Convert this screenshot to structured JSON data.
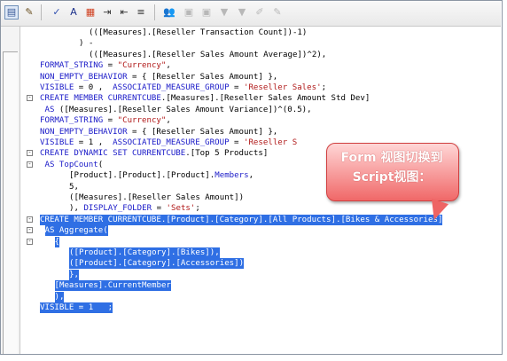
{
  "toolbar": {
    "buttons": [
      {
        "name": "form-view",
        "glyph": "▤",
        "color": "#3a5a98",
        "pressed": true
      },
      {
        "name": "script-view",
        "glyph": "✎",
        "color": "#6a5020",
        "pressed": false
      },
      {
        "name": "check-syntax",
        "glyph": "✓",
        "color": "#3050b0",
        "pressed": false
      },
      {
        "name": "font",
        "glyph": "A",
        "color": "#1a2f8a",
        "pressed": false
      },
      {
        "name": "color",
        "glyph": "▦",
        "color": "#d04020",
        "pressed": false
      },
      {
        "name": "indent",
        "glyph": "⇥",
        "color": "#333333",
        "pressed": false
      },
      {
        "name": "outdent",
        "glyph": "⇤",
        "color": "#333333",
        "pressed": false
      },
      {
        "name": "align",
        "glyph": "≡",
        "color": "#333333",
        "pressed": false
      },
      {
        "name": "users",
        "glyph": "👥",
        "color": "#b07a30",
        "pressed": false
      },
      {
        "name": "disabled-1",
        "glyph": "▣",
        "color": "#b8b8b8",
        "pressed": false
      },
      {
        "name": "disabled-2",
        "glyph": "▣",
        "color": "#b8b8b8",
        "pressed": false
      },
      {
        "name": "disabled-3",
        "glyph": "▼",
        "color": "#b8b8b8",
        "pressed": false
      },
      {
        "name": "disabled-4",
        "glyph": "▼",
        "color": "#b8b8b8",
        "pressed": false
      },
      {
        "name": "disabled-5",
        "glyph": "✐",
        "color": "#b8b8b8",
        "pressed": false
      },
      {
        "name": "disabled-6",
        "glyph": "✎",
        "color": "#b8b8b8",
        "pressed": false
      }
    ]
  },
  "code": [
    {
      "indent": 10,
      "parts": [
        [
          "t",
          "(([Measures].[Reseller Transaction Count])-1)"
        ]
      ]
    },
    {
      "indent": 8,
      "parts": [
        [
          "t",
          ") -"
        ]
      ]
    },
    {
      "indent": 10,
      "parts": [
        [
          "t",
          "(([Measures].[Reseller Sales Amount Average])^2),"
        ]
      ]
    },
    {
      "indent": 0,
      "parts": [
        [
          "k",
          "FORMAT_STRING"
        ],
        [
          "t",
          " = "
        ],
        [
          "s",
          "\"Currency\""
        ],
        [
          "t",
          ","
        ]
      ]
    },
    {
      "indent": 0,
      "parts": [
        [
          "k",
          "NON_EMPTY_BEHAVIOR"
        ],
        [
          "t",
          " = { [Reseller Sales Amount] },"
        ]
      ]
    },
    {
      "indent": 0,
      "parts": [
        [
          "k",
          "VISIBLE"
        ],
        [
          "t",
          " = 0 ,  "
        ],
        [
          "k",
          "ASSOCIATED_MEASURE_GROUP"
        ],
        [
          "t",
          " = "
        ],
        [
          "s",
          "'Reseller Sales'"
        ],
        [
          "t",
          ";"
        ]
      ]
    },
    {
      "indent": 0,
      "fold": "-",
      "parts": [
        [
          "k",
          "CREATE MEMBER CURRENTCUBE"
        ],
        [
          "t",
          ".[Measures].[Reseller Sales Amount Std Dev]"
        ]
      ]
    },
    {
      "indent": 1,
      "parts": [
        [
          "k",
          "AS"
        ],
        [
          "t",
          " ([Measures].[Reseller Sales Amount Variance])^(0.5),"
        ]
      ]
    },
    {
      "indent": 0,
      "parts": [
        [
          "k",
          "FORMAT_STRING"
        ],
        [
          "t",
          " = "
        ],
        [
          "s",
          "\"Currency\""
        ],
        [
          "t",
          ","
        ]
      ]
    },
    {
      "indent": 0,
      "parts": [
        [
          "k",
          "NON_EMPTY_BEHAVIOR"
        ],
        [
          "t",
          " = { [Reseller Sales Amount] },"
        ]
      ]
    },
    {
      "indent": 0,
      "parts": [
        [
          "k",
          "VISIBLE"
        ],
        [
          "t",
          " = 1 ,  "
        ],
        [
          "k",
          "ASSOCIATED_MEASURE_GROUP"
        ],
        [
          "t",
          " = "
        ],
        [
          "s",
          "'Reseller S"
        ]
      ]
    },
    {
      "indent": 0,
      "fold": "-",
      "parts": [
        [
          "k",
          "CREATE DYNAMIC SET CURRENTCUBE"
        ],
        [
          "t",
          ".[Top 5 Products]"
        ]
      ]
    },
    {
      "indent": 1,
      "fold": "-",
      "parts": [
        [
          "k",
          "AS TopCount"
        ],
        [
          "t",
          "("
        ]
      ]
    },
    {
      "indent": 6,
      "parts": [
        [
          "t",
          "[Product].[Product].[Product]."
        ],
        [
          "k",
          "Members"
        ],
        [
          "t",
          ","
        ]
      ]
    },
    {
      "indent": 6,
      "parts": [
        [
          "t",
          "5,"
        ]
      ]
    },
    {
      "indent": 6,
      "parts": [
        [
          "t",
          "([Measures].[Reseller Sales Amount])"
        ]
      ]
    },
    {
      "indent": 6,
      "parts": [
        [
          "t",
          "), "
        ],
        [
          "k",
          "DISPLAY_FOLDER"
        ],
        [
          "t",
          " = "
        ],
        [
          "s",
          "'Sets'"
        ],
        [
          "t",
          ";"
        ]
      ]
    },
    {
      "indent": 0,
      "fold": "-",
      "hl": true,
      "parts": [
        [
          "k",
          "CREATE MEMBER CURRENTCUBE"
        ],
        [
          "t",
          ".[Product].[Category].[All Products].[Bikes & Accessories]"
        ]
      ]
    },
    {
      "indent": 1,
      "fold": "-",
      "hl": true,
      "parts": [
        [
          "k",
          "AS Aggregate"
        ],
        [
          "t",
          "("
        ]
      ]
    },
    {
      "indent": 3,
      "fold": "-",
      "hl": true,
      "parts": [
        [
          "t",
          "{"
        ]
      ]
    },
    {
      "indent": 6,
      "hl": true,
      "parts": [
        [
          "t",
          "([Product].[Category].[Bikes]),"
        ]
      ]
    },
    {
      "indent": 6,
      "hl": true,
      "parts": [
        [
          "t",
          "([Product].[Category].[Accessories])"
        ]
      ]
    },
    {
      "indent": 6,
      "hl": true,
      "parts": [
        [
          "t",
          "},"
        ]
      ]
    },
    {
      "indent": 3,
      "hl": true,
      "parts": [
        [
          "t",
          "[Measures]."
        ],
        [
          "k",
          "CurrentMember"
        ]
      ]
    },
    {
      "indent": 3,
      "hl": true,
      "parts": [
        [
          "t",
          "),"
        ]
      ]
    },
    {
      "indent": 0,
      "hl": true,
      "parts": [
        [
          "k",
          "VISIBLE"
        ],
        [
          "t",
          " = 1   ;"
        ]
      ]
    }
  ],
  "callout": {
    "line1": "Form 视图切换到",
    "line2": "Script视图：",
    "color": "#f06868"
  },
  "colors": {
    "keyword": "#1a1ac8",
    "string": "#b01818",
    "selection": "#2f6fe4"
  }
}
